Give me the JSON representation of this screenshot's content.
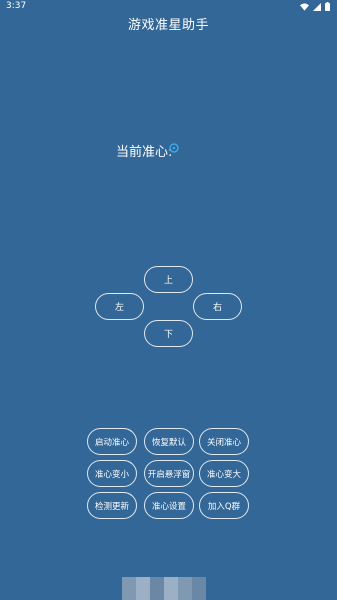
{
  "status_bar": {
    "time": "3:37"
  },
  "app": {
    "title": "游戏准星助手"
  },
  "crosshair": {
    "label": "当前准心:"
  },
  "direction": {
    "up": "上",
    "left": "左",
    "right": "右",
    "down": "下"
  },
  "actions": {
    "start": "启动准心",
    "reset": "恢复默认",
    "close": "关闭准心",
    "shrink": "准心变小",
    "float": "开启悬浮窗",
    "enlarge": "准心变大",
    "update": "检测更新",
    "settings": "准心设置",
    "join_group": "加入Q群"
  },
  "colors": {
    "background": "#336797",
    "crosshair": "#3db4f2"
  }
}
